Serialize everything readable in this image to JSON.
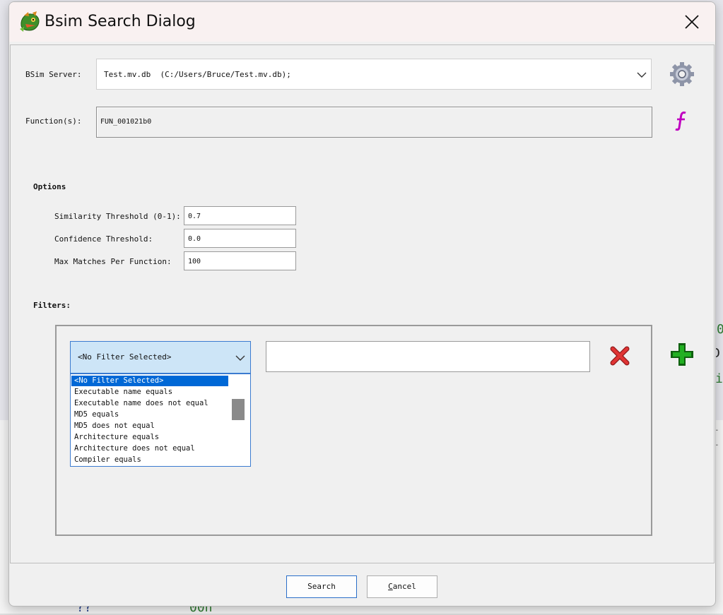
{
  "window": {
    "title": "Bsim Search Dialog",
    "icon": "ghidra-dragon-icon"
  },
  "server": {
    "label": "BSim Server:",
    "value": "Test.mv.db  (C:/Users/Bruce/Test.mv.db);"
  },
  "functions": {
    "label": "Function(s):",
    "value": "FUN_001021b0"
  },
  "options": {
    "heading": "Options",
    "similarity": {
      "label": "Similarity Threshold (0-1):",
      "value": "0.7"
    },
    "confidence": {
      "label": "Confidence Threshold:",
      "value": "0.0"
    },
    "max_matches": {
      "label": "Max Matches Per Function:",
      "value": "100"
    }
  },
  "filters": {
    "heading": "Filters:",
    "selected": "<No Filter Selected>",
    "options": [
      "<No Filter Selected>",
      "Executable name equals",
      "Executable name does not equal",
      "MD5 equals",
      "MD5 does not equal",
      "Architecture equals",
      "Architecture does not equal",
      "Compiler equals"
    ],
    "value": ""
  },
  "buttons": {
    "search": "Search",
    "cancel_first": "C",
    "cancel_rest": "ancel"
  },
  "background": {
    "t1": "0",
    "t2": "D",
    "t3": "i",
    "t4": "--",
    "t5": "??",
    "t6": "00h"
  },
  "colors": {
    "accent": "#0068d6",
    "delete": "#d42b2b",
    "add": "#18a018",
    "function_icon": "#c000c0"
  }
}
